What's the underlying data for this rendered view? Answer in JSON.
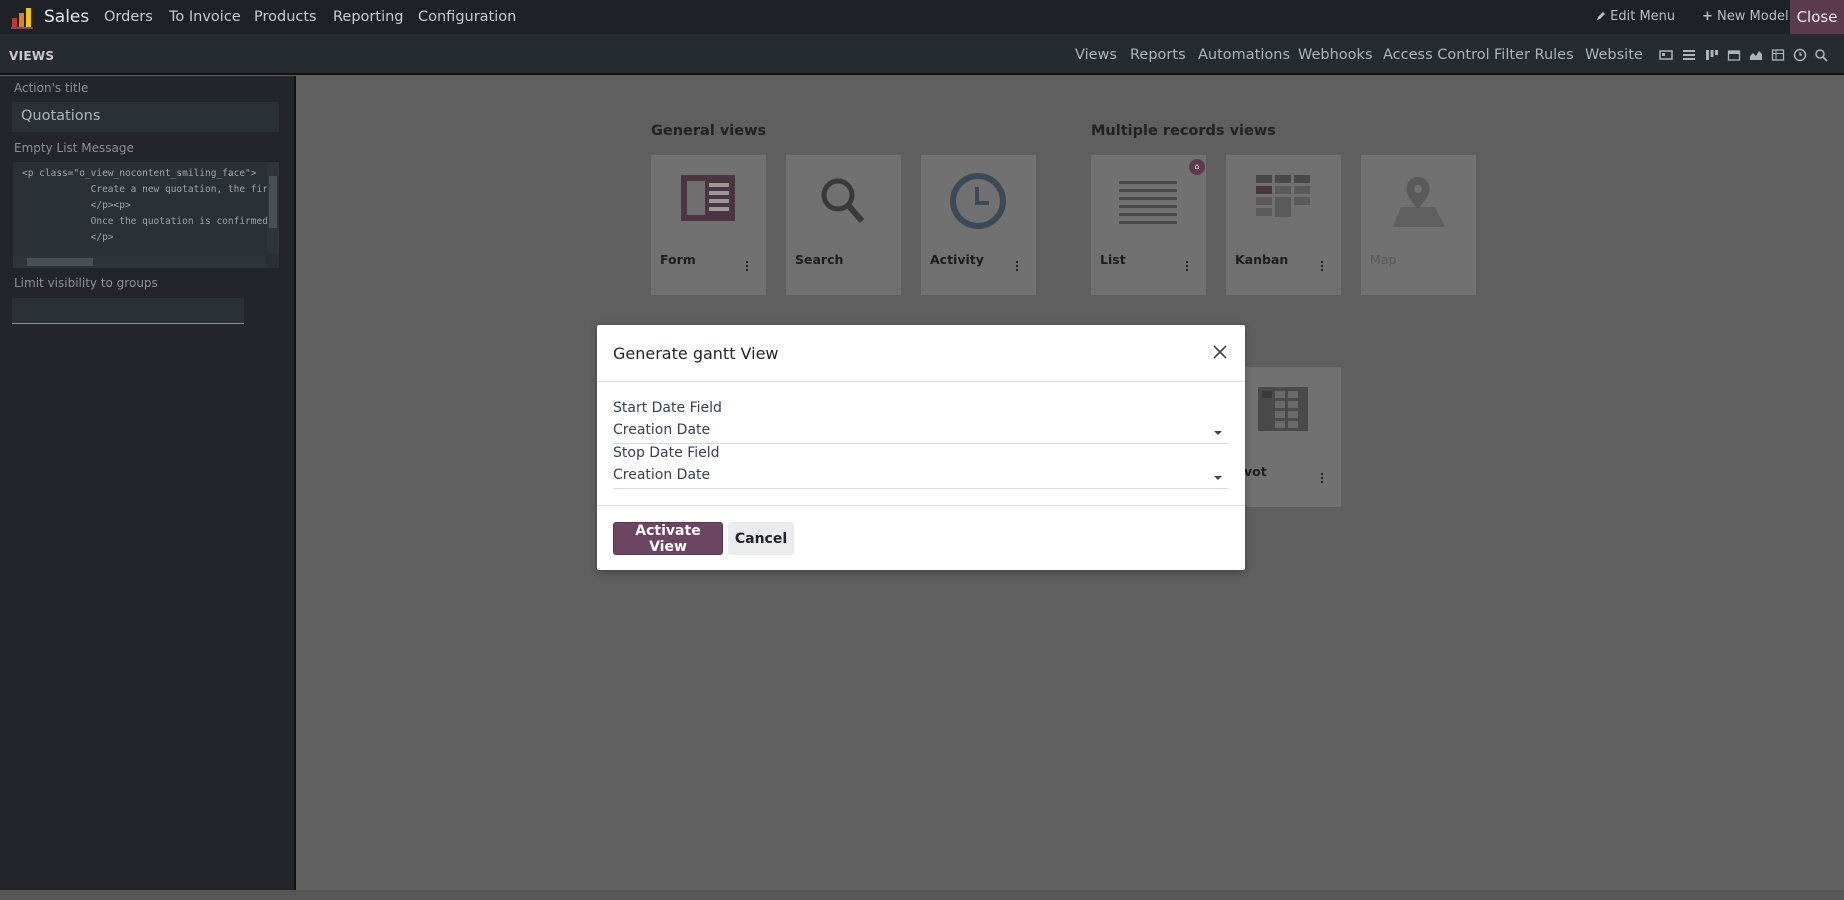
{
  "topbar": {
    "app_name": "Sales",
    "menu": [
      "Orders",
      "To Invoice",
      "Products",
      "Reporting",
      "Configuration"
    ],
    "edit_menu": "Edit Menu",
    "new_model": "New Model",
    "close": "Close"
  },
  "subbar": {
    "title": "VIEWS",
    "nav": [
      "Views",
      "Reports",
      "Automations",
      "Webhooks",
      "Access Control",
      "Filter Rules",
      "Website"
    ],
    "view_icons": [
      "form-view-icon",
      "list-view-icon",
      "kanban-view-icon",
      "calendar-view-icon",
      "graph-view-icon",
      "pivot-view-icon",
      "activity-view-icon",
      "search-view-icon"
    ]
  },
  "sidebar": {
    "action_title_label": "Action's title",
    "action_title_value": "Quotations",
    "empty_list_label": "Empty List Message",
    "empty_list_code": [
      "<p class=\"o_view_nocontent_smiling_face\">",
      "            Create a new quotation, the firs",
      "            </p><p>",
      "            Once the quotation is confirmed",
      "            </p>"
    ],
    "groups_label": "Limit visibility to groups"
  },
  "main": {
    "general_title": "General views",
    "multiple_title": "Multiple records views",
    "cards": {
      "form": "Form",
      "search": "Search",
      "activity": "Activity",
      "list": "List",
      "kanban": "Kanban",
      "map": "Map",
      "pivot": "Pivot"
    },
    "pivot_visible": "vot"
  },
  "modal": {
    "title": "Generate gantt View",
    "start_label": "Start Date Field",
    "start_value": "Creation Date",
    "stop_label": "Stop Date Field",
    "stop_value": "Creation Date",
    "activate": "Activate View",
    "cancel": "Cancel"
  },
  "colors": {
    "primary": "#6b4562",
    "close_bg": "#5d3b4f",
    "overlay": "#5f5f5f"
  }
}
